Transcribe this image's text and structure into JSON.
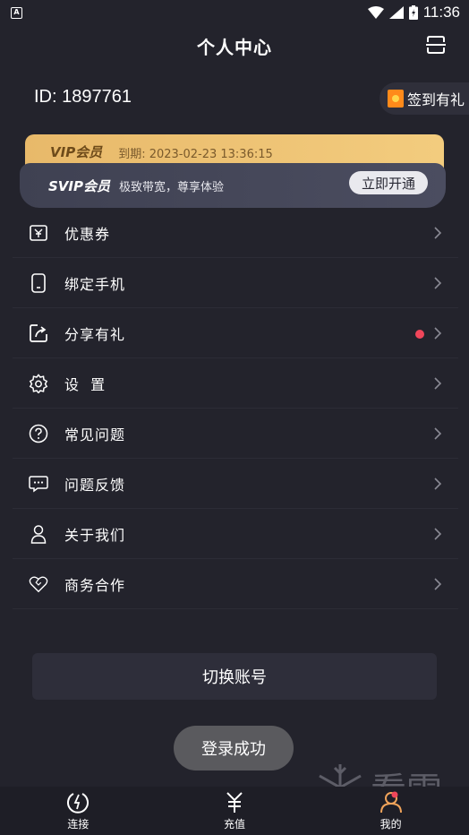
{
  "status_bar": {
    "time": "11:36"
  },
  "header": {
    "title": "个人中心"
  },
  "profile": {
    "id_text": "ID: 1897761",
    "checkin_label": "签到有礼"
  },
  "vip": {
    "vip_title": "VIP会员",
    "vip_expire": "到期: 2023-02-23 13:36:15",
    "svip_title": "SVIP会员",
    "svip_desc": "极致带宽，尊享体验",
    "open_label": "立即开通"
  },
  "menu": {
    "items": [
      {
        "label": "优惠券",
        "icon": "coupon-icon"
      },
      {
        "label": "绑定手机",
        "icon": "phone-icon"
      },
      {
        "label": "分享有礼",
        "icon": "share-icon"
      },
      {
        "label": "设  置",
        "icon": "gear-icon"
      },
      {
        "label": "常见问题",
        "icon": "question-icon"
      },
      {
        "label": "问题反馈",
        "icon": "feedback-icon"
      },
      {
        "label": "关于我们",
        "icon": "user-icon"
      },
      {
        "label": "商务合作",
        "icon": "heart-icon"
      }
    ]
  },
  "switch_account_label": "切换账号",
  "toast": "登录成功",
  "bottom_nav": {
    "items": [
      {
        "label": "连接",
        "icon": "connect-icon"
      },
      {
        "label": "充值",
        "icon": "yen-icon"
      },
      {
        "label": "我的",
        "icon": "profile-icon"
      }
    ]
  },
  "watermark": {
    "text": "看雪"
  },
  "colors": {
    "background": "#23232c",
    "vip_gold": "#f3cc7e",
    "accent_red": "#f0465a"
  }
}
